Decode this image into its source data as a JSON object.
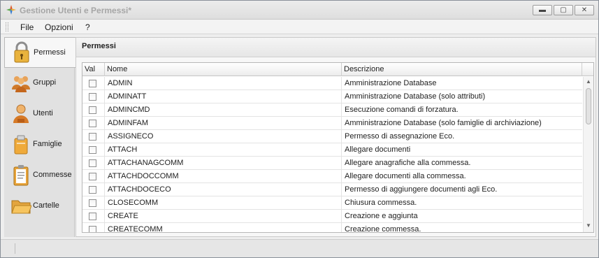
{
  "window": {
    "title": "Gestione Utenti e Permessi*",
    "controls": {
      "minimize": "▬",
      "maximize": "▢",
      "close": "✕"
    }
  },
  "menu": {
    "items": [
      "File",
      "Opzioni",
      "?"
    ]
  },
  "nav": {
    "active": "Permessi",
    "items": [
      {
        "label": "Permessi",
        "icon": "padlock-icon"
      },
      {
        "label": "Gruppi",
        "icon": "group-icon"
      },
      {
        "label": "Utenti",
        "icon": "user-icon"
      },
      {
        "label": "Famiglie",
        "icon": "families-icon"
      },
      {
        "label": "Commesse",
        "icon": "clipboard-icon"
      },
      {
        "label": "Cartelle",
        "icon": "folder-icon"
      }
    ]
  },
  "panel": {
    "title": "Permessi",
    "grid": {
      "columns": [
        "Val",
        "Nome",
        "Descrizione"
      ],
      "rows": [
        {
          "checked": false,
          "name": "ADMIN",
          "description": "Amministrazione Database"
        },
        {
          "checked": false,
          "name": "ADMINATT",
          "description": "Amministrazione Database (solo attributi)"
        },
        {
          "checked": false,
          "name": "ADMINCMD",
          "description": "Esecuzione comandi di forzatura."
        },
        {
          "checked": false,
          "name": "ADMINFAM",
          "description": "Amministrazione Database (solo famiglie di archiviazione)"
        },
        {
          "checked": false,
          "name": "ASSIGNECO",
          "description": "Permesso di assegnazione Eco."
        },
        {
          "checked": false,
          "name": "ATTACH",
          "description": "Allegare documenti"
        },
        {
          "checked": false,
          "name": "ATTACHANAGCOMM",
          "description": "Allegare anagrafiche alla commessa."
        },
        {
          "checked": false,
          "name": "ATTACHDOCCOMM",
          "description": "Allegare documenti alla commessa."
        },
        {
          "checked": false,
          "name": "ATTACHDOCECO",
          "description": "Permesso di aggiungere documenti agli Eco."
        },
        {
          "checked": false,
          "name": "CLOSECOMM",
          "description": "Chiusura commessa."
        },
        {
          "checked": false,
          "name": "CREATE",
          "description": "Creazione e aggiunta"
        },
        {
          "checked": false,
          "name": "CREATECOMM",
          "description": "Creazione commessa."
        }
      ]
    }
  },
  "colors": {
    "accent_orange": "#e9a23b",
    "window_bg": "#eeeeee",
    "grid_bg": "#ffffff"
  }
}
